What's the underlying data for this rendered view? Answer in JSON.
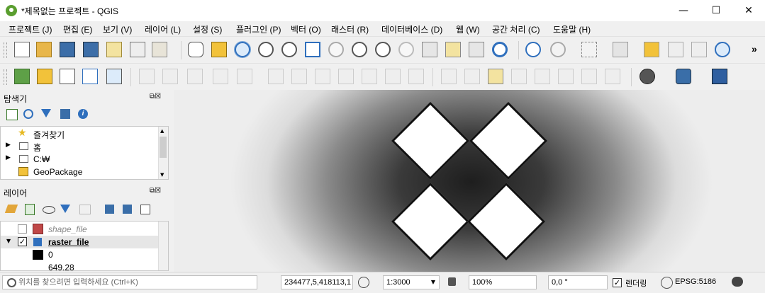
{
  "window": {
    "title": "*제목없는 프로젝트 - QGIS",
    "minimize": "—",
    "maximize": "☐",
    "close": "✕"
  },
  "menu": [
    "프로젝트 (J)",
    "편집 (E)",
    "보기 (V)",
    "레이어 (L)",
    "설정 (S)",
    "플러그인 (P)",
    "벡터 (O)",
    "래스터 (R)",
    "데이터베이스 (D)",
    "웹 (W)",
    "공간 처리 (C)",
    "도움말 (H)"
  ],
  "toolbar": {
    "overflow": "»"
  },
  "browser": {
    "title": "탐색기",
    "items": [
      {
        "label": "즐겨찾기",
        "icon": "star-icon"
      },
      {
        "label": "홈",
        "icon": "home-folder-icon"
      },
      {
        "label": "C:₩",
        "icon": "drive-folder-icon"
      },
      {
        "label": "GeoPackage",
        "icon": "geopackage-icon"
      }
    ]
  },
  "layers": {
    "title": "레이어",
    "items": [
      {
        "label": "shape_file",
        "checked": false,
        "color": "#c04848"
      },
      {
        "label": "raster_file",
        "checked": true
      }
    ],
    "legend": {
      "min": "0",
      "max": "649.28"
    }
  },
  "statusbar": {
    "locator_placeholder": "위치를 찾으려면 입력하세요 (Ctrl+K)",
    "coordinate": "234477,5,418113,1",
    "scale": "1:3000",
    "magnifier": "100%",
    "rotation": "0,0 °",
    "render_label": "렌더링",
    "render_checked": true,
    "crs": "EPSG:5186"
  },
  "colors": {
    "qgis_green": "#5a9e2f",
    "accent_blue": "#2f6fbd"
  }
}
